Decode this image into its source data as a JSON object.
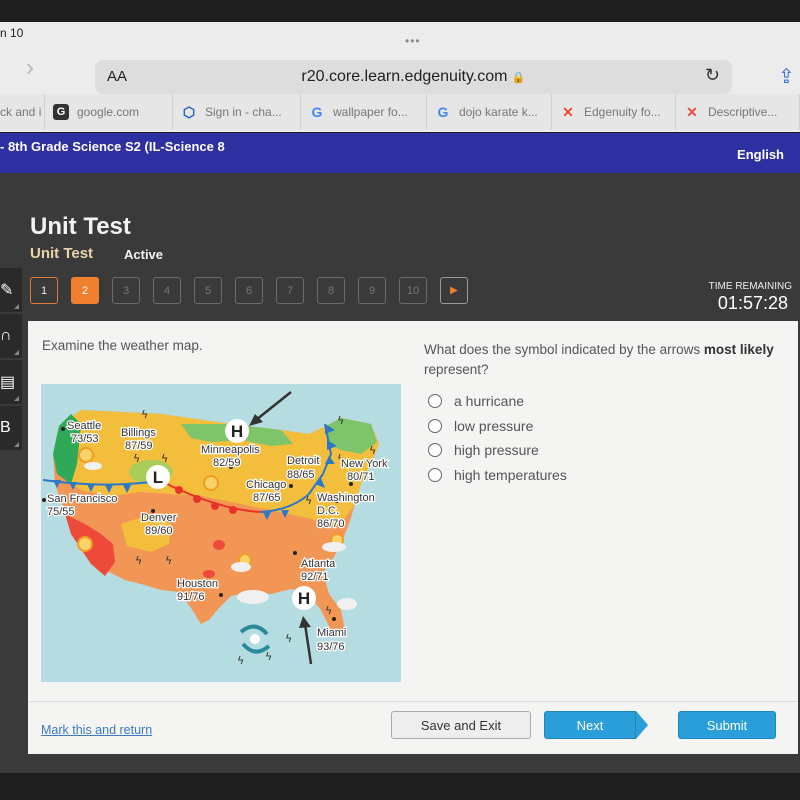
{
  "browser": {
    "status_fragment": "n 10",
    "text_size_label": "AA",
    "url": "r20.core.learn.edgenuity.com",
    "tabs": [
      {
        "label": "ck and i",
        "icon": "none"
      },
      {
        "label": "google.com",
        "icon": "google-dark-icon"
      },
      {
        "label": "Sign in - cha...",
        "icon": "chase-icon"
      },
      {
        "label": "wallpaper fo...",
        "icon": "google-icon"
      },
      {
        "label": "dojo karate k...",
        "icon": "google-icon"
      },
      {
        "label": "Edgenuity fo...",
        "icon": "edgenuity-icon"
      },
      {
        "label": "Descriptive...",
        "icon": "edgenuity-icon"
      }
    ]
  },
  "course_bar": {
    "title": "- 8th Grade Science S2 (IL-Science 8",
    "language": "English"
  },
  "header": {
    "title": "Unit Test",
    "subtitle": "Unit Test",
    "status": "Active"
  },
  "question_nav": {
    "items": [
      {
        "label": "1",
        "state": "done"
      },
      {
        "label": "2",
        "state": "current"
      },
      {
        "label": "3",
        "state": "locked"
      },
      {
        "label": "4",
        "state": "locked"
      },
      {
        "label": "5",
        "state": "locked"
      },
      {
        "label": "6",
        "state": "locked"
      },
      {
        "label": "7",
        "state": "locked"
      },
      {
        "label": "8",
        "state": "locked"
      },
      {
        "label": "9",
        "state": "locked"
      },
      {
        "label": "10",
        "state": "locked"
      }
    ],
    "next_glyph": "▶"
  },
  "timer": {
    "label": "TIME REMAINING",
    "value": "01:57:28"
  },
  "sidebar_tools": [
    "pencil-icon",
    "headphones-icon",
    "calculator-icon",
    "reference-icon"
  ],
  "content": {
    "prompt": "Examine the weather map.",
    "question_part1": "What does the symbol indicated by the arrows ",
    "question_bold1": "most",
    "question_bold2": "likely",
    "question_part2": " represent?",
    "options": [
      "a hurricane",
      "low pressure",
      "high pressure",
      "high temperatures"
    ],
    "map": {
      "cities": [
        {
          "name": "Seattle",
          "temps": "73/53"
        },
        {
          "name": "Billings",
          "temps": "87/59"
        },
        {
          "name": "Minneapolis",
          "temps": "82/59"
        },
        {
          "name": "Detroit",
          "temps": "88/65"
        },
        {
          "name": "New York",
          "temps": "80/71"
        },
        {
          "name": "Chicago",
          "temps": "87/65"
        },
        {
          "name": "Washington",
          "name2": "D.C.",
          "temps": "86/70"
        },
        {
          "name": "San Francisco",
          "temps": "75/55"
        },
        {
          "name": "Denver",
          "temps": "89/60"
        },
        {
          "name": "Atlanta",
          "temps": "92/71"
        },
        {
          "name": "Houston",
          "temps": "91/76"
        },
        {
          "name": "Miami",
          "temps": "93/76"
        }
      ],
      "pressure_symbols": {
        "high": "H",
        "low": "L"
      }
    }
  },
  "footer": {
    "mark_link": "Mark this and return",
    "save_exit": "Save and Exit",
    "next": "Next",
    "submit": "Submit"
  },
  "colors": {
    "course_bar": "#2e2fa0",
    "accent_orange": "#f08030",
    "button_blue": "#2a9ed8",
    "link_blue": "#3b7bbf"
  }
}
